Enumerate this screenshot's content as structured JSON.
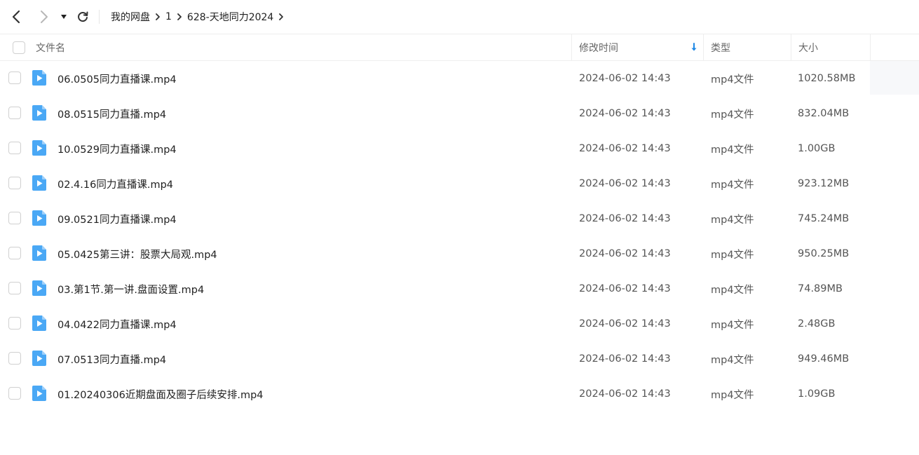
{
  "toolbar": {
    "back_icon": "chevron-left-icon",
    "forward_icon": "chevron-right-icon",
    "dropdown_icon": "caret-down-icon",
    "refresh_icon": "refresh-icon"
  },
  "breadcrumb": {
    "items": [
      "我的网盘",
      "1",
      "628-天地同力2024"
    ]
  },
  "table": {
    "columns": {
      "name": "文件名",
      "modified": "修改时间",
      "type": "类型",
      "size": "大小"
    },
    "sort_icon": "sort-down-arrow-icon",
    "accent_color": "#1e88e5",
    "icon_color": "#4aa8f5",
    "rows": [
      {
        "name": "06.0505同力直播课.mp4",
        "modified": "2024-06-02 14:43",
        "type": "mp4文件",
        "size": "1020.58MB"
      },
      {
        "name": "08.0515同力直播.mp4",
        "modified": "2024-06-02 14:43",
        "type": "mp4文件",
        "size": "832.04MB"
      },
      {
        "name": "10.0529同力直播课.mp4",
        "modified": "2024-06-02 14:43",
        "type": "mp4文件",
        "size": "1.00GB"
      },
      {
        "name": "02.4.16同力直播课.mp4",
        "modified": "2024-06-02 14:43",
        "type": "mp4文件",
        "size": "923.12MB"
      },
      {
        "name": "09.0521同力直播课.mp4",
        "modified": "2024-06-02 14:43",
        "type": "mp4文件",
        "size": "745.24MB"
      },
      {
        "name": "05.0425第三讲：股票大局观.mp4",
        "modified": "2024-06-02 14:43",
        "type": "mp4文件",
        "size": "950.25MB"
      },
      {
        "name": "03.第1节.第一讲.盘面设置.mp4",
        "modified": "2024-06-02 14:43",
        "type": "mp4文件",
        "size": "74.89MB"
      },
      {
        "name": "04.0422同力直播课.mp4",
        "modified": "2024-06-02 14:43",
        "type": "mp4文件",
        "size": "2.48GB"
      },
      {
        "name": "07.0513同力直播.mp4",
        "modified": "2024-06-02 14:43",
        "type": "mp4文件",
        "size": "949.46MB"
      },
      {
        "name": "01.20240306近期盘面及圈子后续安排.mp4",
        "modified": "2024-06-02 14:43",
        "type": "mp4文件",
        "size": "1.09GB"
      }
    ]
  }
}
